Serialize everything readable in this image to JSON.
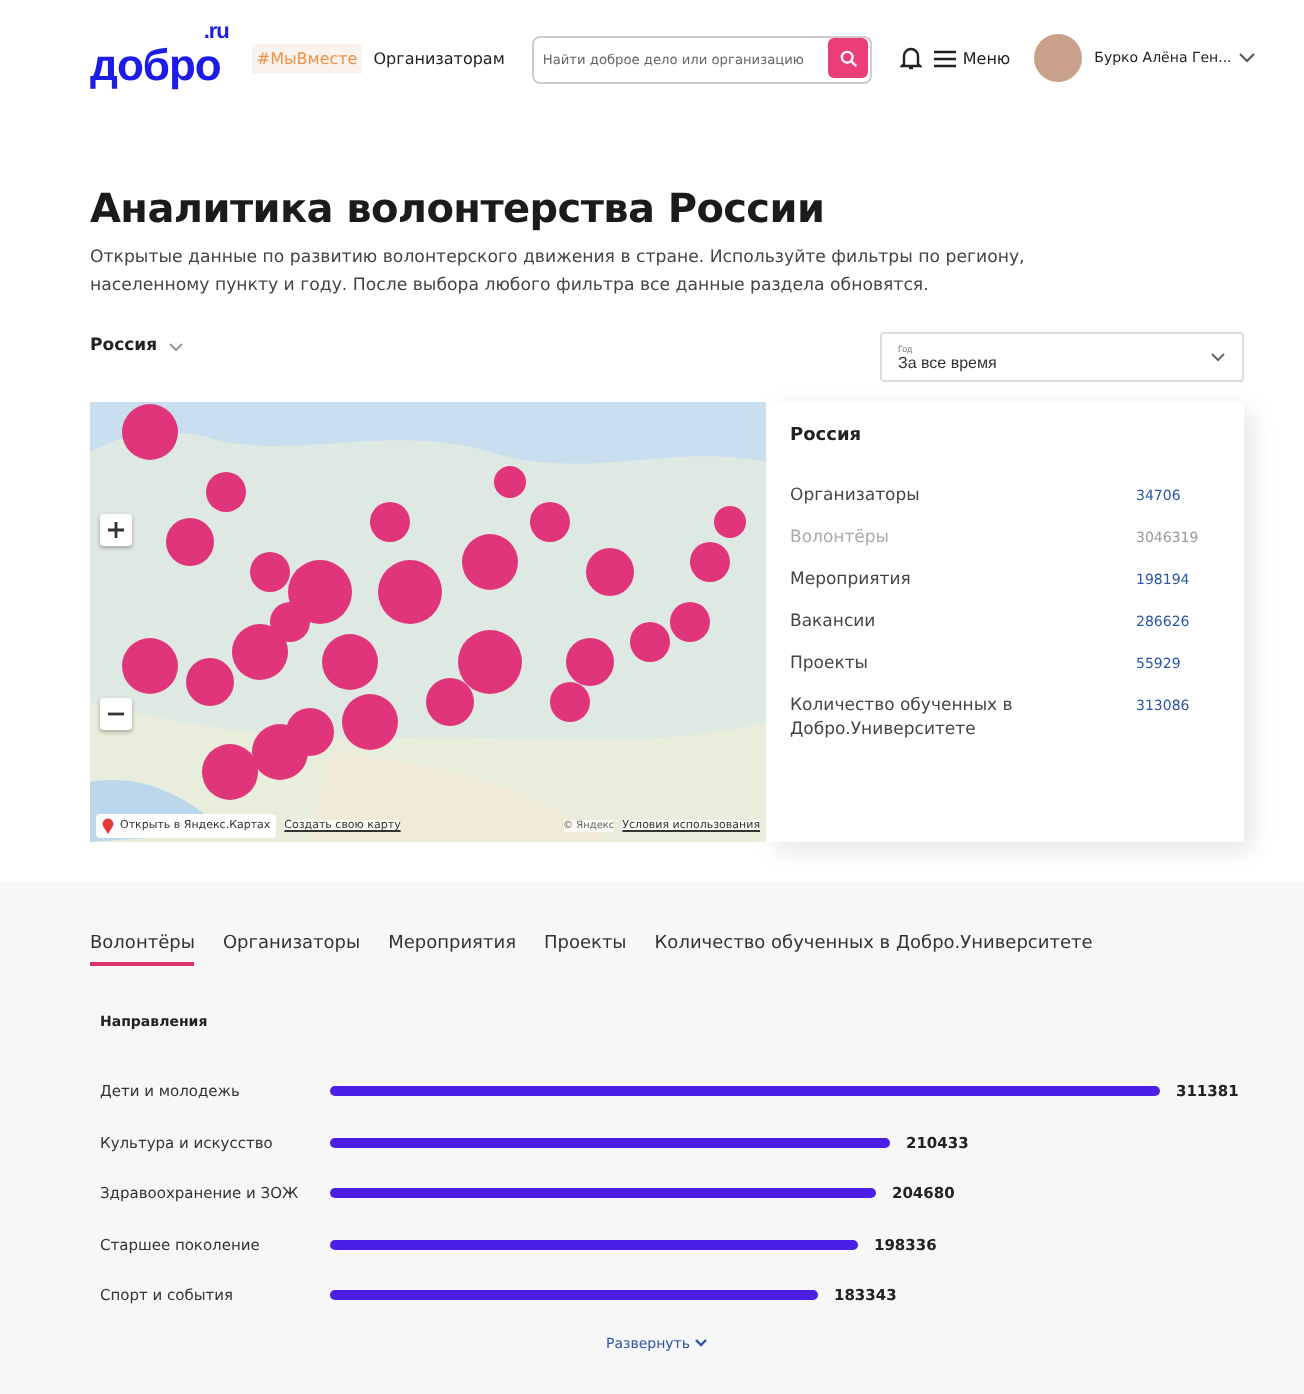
{
  "header": {
    "logo": "добро",
    "logo_suffix": ".ru",
    "tag": "#МыВместе",
    "nav_link": "Организаторам",
    "search": {
      "placeholder": "Найти доброе дело или организацию"
    },
    "menu_label": "Меню",
    "user_name": "Бурко Алёна Ген..."
  },
  "page": {
    "title": "Аналитика волонтерства России",
    "description": "Открытые данные по развитию волонтерского движения в стране. Используйте фильтры по региону, населенному пункту и году. После выбора любого фильтра все данные раздела обновятся."
  },
  "filters": {
    "region": "Россия",
    "year": {
      "label": "Год",
      "value": "За все время"
    }
  },
  "map": {
    "kind": "picture",
    "open_link": "Открыть в Яндекс.Картах",
    "create_link": "Создать свою карту",
    "copyright": "© Яндекс",
    "terms_link": "Условия использования"
  },
  "stats": {
    "title": "Россия",
    "rows": [
      {
        "label": "Организаторы",
        "value": "34706",
        "muted": false
      },
      {
        "label": "Волонтёры",
        "value": "3046319",
        "muted": true
      },
      {
        "label": "Мероприятия",
        "value": "198194",
        "muted": false
      },
      {
        "label": "Вакансии",
        "value": "286626",
        "muted": false
      },
      {
        "label": "Проекты",
        "value": "55929",
        "muted": false
      },
      {
        "label": "Количество обученных в Добро.Университете",
        "value": "313086",
        "muted": false
      }
    ]
  },
  "tabs": [
    {
      "label": "Волонтёры",
      "selected": true
    },
    {
      "label": "Организаторы",
      "selected": false
    },
    {
      "label": "Мероприятия",
      "selected": false
    },
    {
      "label": "Проекты",
      "selected": false
    },
    {
      "label": "Количество обученных в Добро.Университете",
      "selected": false
    }
  ],
  "directions": {
    "title": "Направления",
    "rows": [
      {
        "label": "Дети и молодежь",
        "value": "311381"
      },
      {
        "label": "Культура и искусство",
        "value": "210433"
      },
      {
        "label": "Здравоохранение и ЗОЖ",
        "value": "204680"
      },
      {
        "label": "Старшее поколение",
        "value": "198336"
      },
      {
        "label": "Спорт и события",
        "value": "183343"
      }
    ],
    "expand": "Развернуть"
  }
}
